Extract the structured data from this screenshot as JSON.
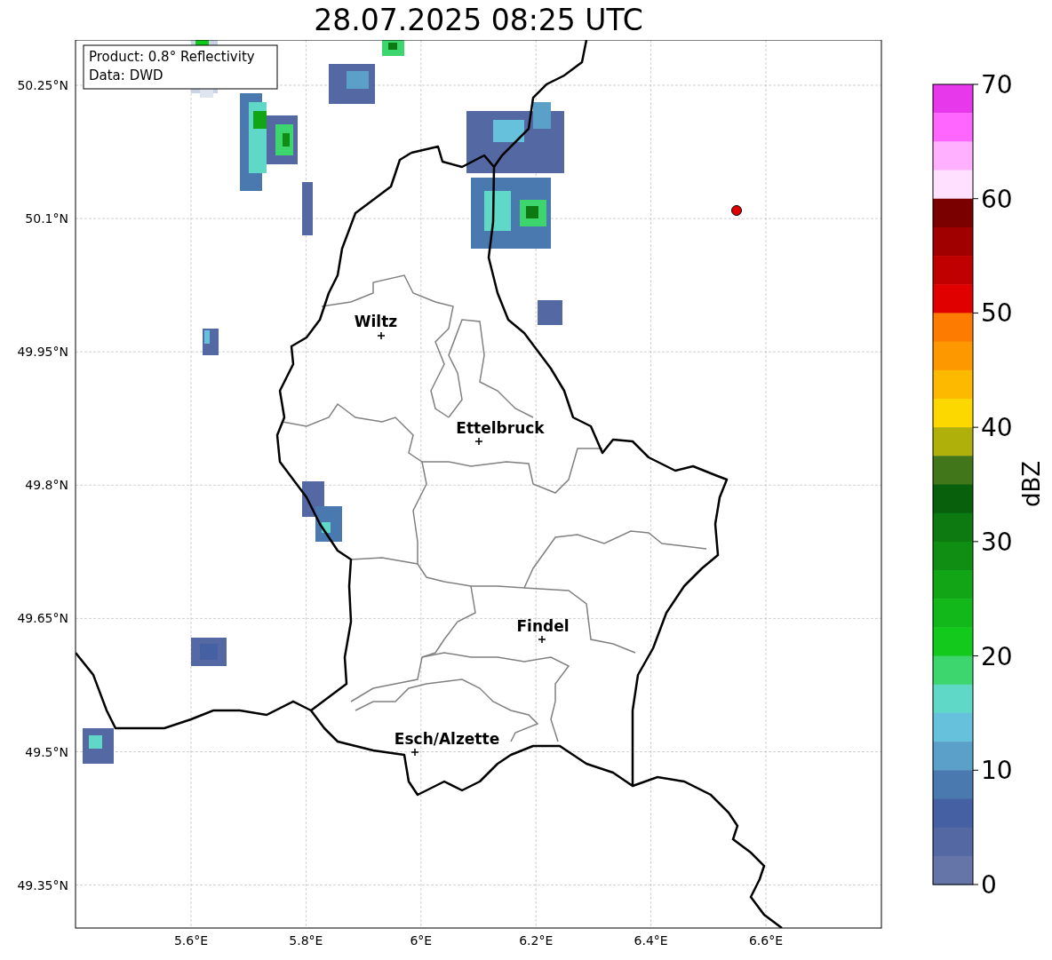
{
  "title": "28.07.2025 08:25 UTC",
  "info_box": [
    "Product: 0.8° Reflectivity",
    "Data: DWD"
  ],
  "map": {
    "lat_ticks": [
      "50.25°N",
      "50.1°N",
      "49.95°N",
      "49.8°N",
      "49.65°N",
      "49.5°N",
      "49.35°N"
    ],
    "lon_ticks": [
      "5.6°E",
      "5.8°E",
      "6°E",
      "6.2°E",
      "6.4°E",
      "6.6°E"
    ],
    "cities": [
      {
        "name": "Wiltz"
      },
      {
        "name": "Ettelbruck"
      },
      {
        "name": "Findel"
      },
      {
        "name": "Esch/Alzette"
      }
    ]
  },
  "colorbar": {
    "label": "dBZ",
    "ticks": [
      "70",
      "60",
      "50",
      "40",
      "30",
      "20",
      "10",
      "0"
    ],
    "segments": [
      {
        "color": "#e838ec"
      },
      {
        "color": "#ff66ff"
      },
      {
        "color": "#ffb0ff"
      },
      {
        "color": "#ffe0ff"
      },
      {
        "color": "#7a0000"
      },
      {
        "color": "#a00000"
      },
      {
        "color": "#c00000"
      },
      {
        "color": "#e00000"
      },
      {
        "color": "#fd7b00"
      },
      {
        "color": "#fd9800"
      },
      {
        "color": "#fdb800"
      },
      {
        "color": "#fdd700"
      },
      {
        "color": "#b0b00a"
      },
      {
        "color": "#42761a"
      },
      {
        "color": "#085f0c"
      },
      {
        "color": "#0c7a10"
      },
      {
        "color": "#108e14"
      },
      {
        "color": "#12a516"
      },
      {
        "color": "#12b81a"
      },
      {
        "color": "#12c91c"
      },
      {
        "color": "#3dd66e"
      },
      {
        "color": "#5fd8c8"
      },
      {
        "color": "#66c2dc"
      },
      {
        "color": "#5ba0c8"
      },
      {
        "color": "#4a79b0"
      },
      {
        "color": "#4560a3"
      },
      {
        "color": "#5468a3"
      },
      {
        "color": "#6675a8"
      }
    ]
  }
}
